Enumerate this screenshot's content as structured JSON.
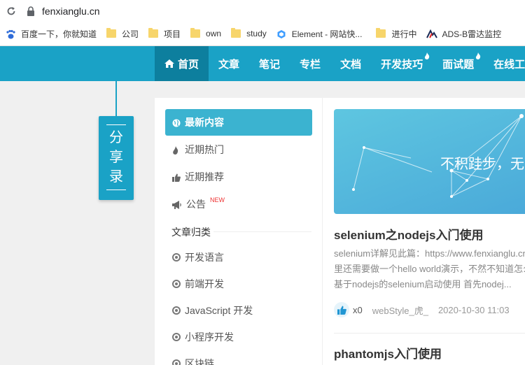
{
  "browser": {
    "url": "fenxianglu.cn",
    "bookmarks": [
      {
        "label": "百度一下，你就知道",
        "icon": "baidu-icon"
      },
      {
        "label": "公司",
        "icon": "folder-icon"
      },
      {
        "label": "项目",
        "icon": "folder-icon"
      },
      {
        "label": "own",
        "icon": "folder-icon"
      },
      {
        "label": "study",
        "icon": "folder-icon"
      },
      {
        "label": "Element - 网站快...",
        "icon": "element-icon"
      },
      {
        "label": "进行中",
        "icon": "folder-icon"
      },
      {
        "label": "ADS-B雷达监控",
        "icon": "ads-icon"
      }
    ]
  },
  "nav": {
    "items": [
      "首页",
      "文章",
      "笔记",
      "专栏",
      "文档",
      "开发技巧",
      "面试题",
      "在线工具"
    ]
  },
  "share": {
    "chars": [
      "分",
      "享",
      "录"
    ]
  },
  "sidebar": {
    "items": [
      "最新内容",
      "近期热门",
      "近期推荐",
      "公告"
    ],
    "new_badge": "NEW",
    "category_title": "文章归类",
    "categories": [
      "开发语言",
      "前端开发",
      "JavaScript 开发",
      "小程序开发",
      "区块链"
    ]
  },
  "main": {
    "banner_text": "不积跬步，无以至千里",
    "post1": {
      "title": "selenium之nodejs入门使用",
      "excerpt_lines": [
        "selenium详解见此篇：https://www.fenxianglu.cn/",
        "里还需要做一个hello world演示，不然不知道怎么",
        "基于nodejs的selenium启动使用 首先nodej..."
      ],
      "likes": "x0",
      "author": "webStyle_虎_",
      "date": "2020-10-30 11:03"
    },
    "post2": {
      "title": "phantomjs入门使用"
    }
  },
  "colors": {
    "brand": "#1aa2c6",
    "nav_active": "#0d7f9e",
    "sidebar_active": "#3bb3d0"
  }
}
